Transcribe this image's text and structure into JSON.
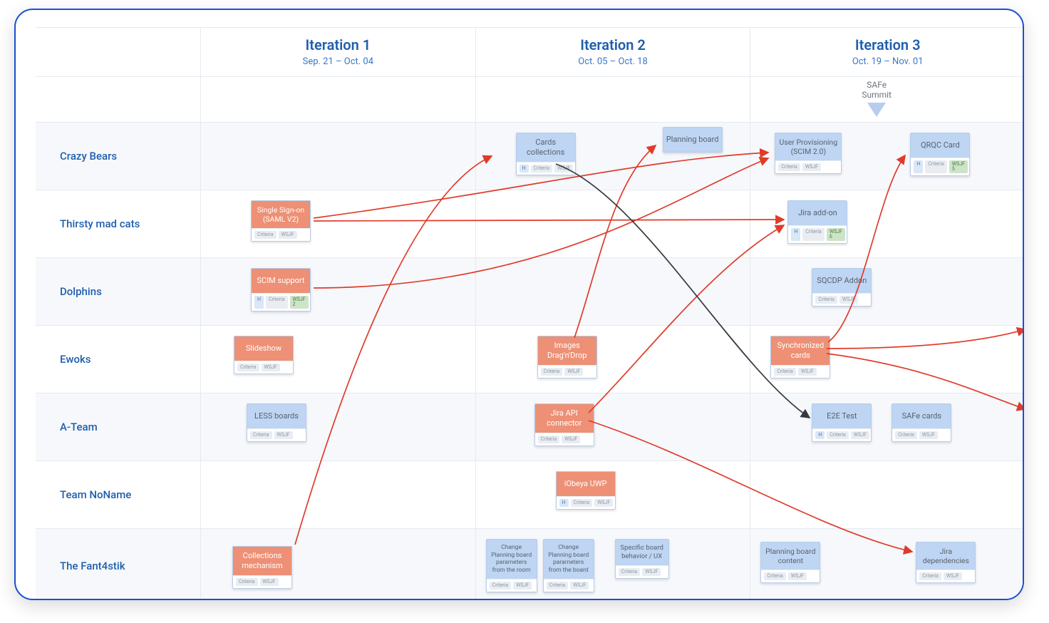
{
  "iterations": [
    {
      "title": "Iteration 1",
      "dates": "Sep. 21 – Oct. 04"
    },
    {
      "title": "Iteration 2",
      "dates": "Oct. 05 – Oct. 18"
    },
    {
      "title": "Iteration 3",
      "dates": "Oct. 19 – Nov. 01"
    }
  ],
  "milestone": {
    "label_l1": "SAFe",
    "label_l2": "Summit"
  },
  "teams": [
    "Crazy Bears",
    "Thirsty mad cats",
    "Dolphins",
    "Ewoks",
    "A-Team",
    "Team NoName",
    "The Fant4stik"
  ],
  "cards": {
    "cards_collections": "Cards collections",
    "planning_board": "Planning board",
    "user_prov": "User Provisioning (SCIM 2.0)",
    "qrqc": "QRQC Card",
    "sso_saml": "Single Sign-on (SAML V2)",
    "jira_addon": "Jira add-on",
    "scim_support": "SCIM support",
    "sqcdp": "SQCDP Addon",
    "slideshow": "Slideshow",
    "images_dnd": "Images Drag'n'Drop",
    "sync_cards": "Synchronized cards",
    "less_boards": "LESS boards",
    "jira_api": "Jira API connector",
    "e2e_test": "E2E Test",
    "safe_cards": "SAFe cards",
    "iobeya_uwp": "iObeya UWP",
    "collections_mech": "Collections mechanism",
    "cpb_room": "Change Planning board parameters from the room",
    "cpb_board": "Change Planning board parameters from the board",
    "spec_board": "Specific board behavior / UX",
    "pb_content": "Planning board content",
    "jira_deps": "Jira dependencies"
  },
  "chips": {
    "h": "H",
    "criteria": "Criteria",
    "wsjf": "WSJF",
    "wsjf2": "WSJF 2",
    "wsjf5": "WSJF 5",
    "wsjf6": "WSJF 6"
  }
}
